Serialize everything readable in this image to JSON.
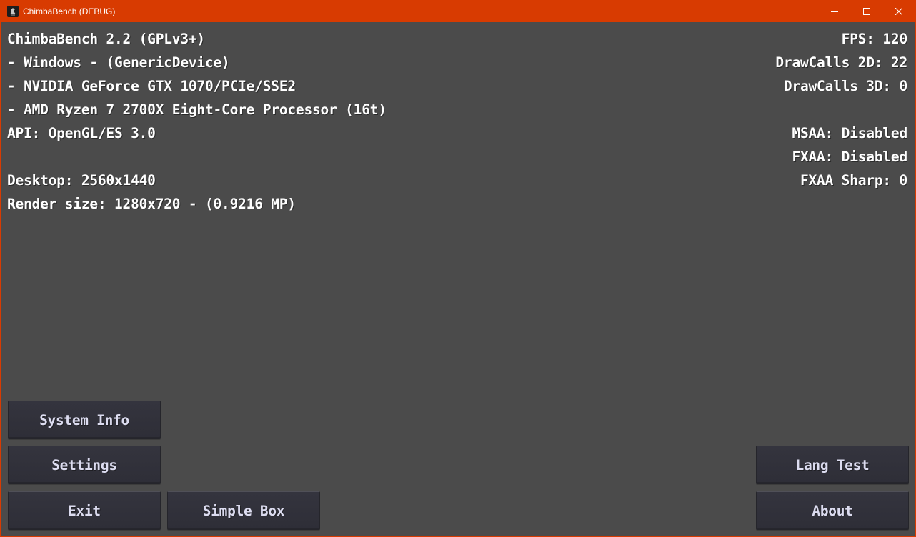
{
  "window": {
    "title": "ChimbaBench (DEBUG)",
    "accent_color": "#d83b01",
    "controls": {
      "minimize_icon": "minimize-icon",
      "maximize_icon": "maximize-icon",
      "close_icon": "close-icon"
    }
  },
  "info": {
    "lines": [
      "ChimbaBench 2.2 (GPLv3+)",
      "- Windows - (GenericDevice)",
      "- NVIDIA GeForce GTX 1070/PCIe/SSE2",
      "- AMD Ryzen 7 2700X Eight-Core Processor (16t)",
      "API: OpenGL/ES 3.0",
      "Desktop: 2560x1440",
      "Render size: 1280x720 - (0.9216 MP)"
    ]
  },
  "stats": {
    "fps": "FPS: 120",
    "drawcalls_2d": "DrawCalls 2D: 22",
    "drawcalls_3d": "DrawCalls 3D: 0",
    "msaa": "MSAA: Disabled",
    "fxaa": "FXAA: Disabled",
    "fxaa_sharp": "FXAA Sharp: 0"
  },
  "buttons": {
    "system_info": "System Info",
    "settings": "Settings",
    "exit": "Exit",
    "simple_box": "Simple Box",
    "lang_test": "Lang Test",
    "about": "About"
  }
}
